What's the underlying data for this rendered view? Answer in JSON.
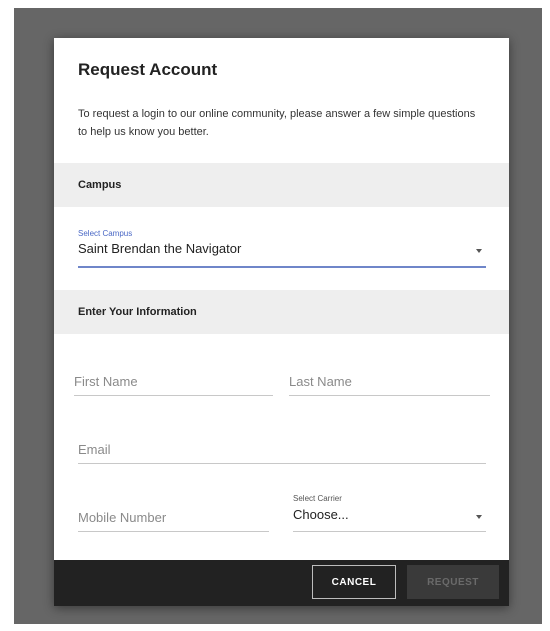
{
  "dialog": {
    "title": "Request Account",
    "intro": "To request a login to our online community, please answer a few simple questions to help us know you better."
  },
  "campus_section": {
    "heading": "Campus",
    "select_label": "Select Campus",
    "selected_value": "Saint Brendan the Navigator"
  },
  "info_section": {
    "heading": "Enter Your Information",
    "first_name_placeholder": "First Name",
    "last_name_placeholder": "Last Name",
    "email_placeholder": "Email",
    "mobile_placeholder": "Mobile Number",
    "carrier_label": "Select Carrier",
    "carrier_value": "Choose..."
  },
  "footer": {
    "cancel_label": "CANCEL",
    "request_label": "REQUEST"
  },
  "colors": {
    "accent": "#6f86c9",
    "footer_bg": "#222222",
    "section_bg": "#eeeeee"
  }
}
